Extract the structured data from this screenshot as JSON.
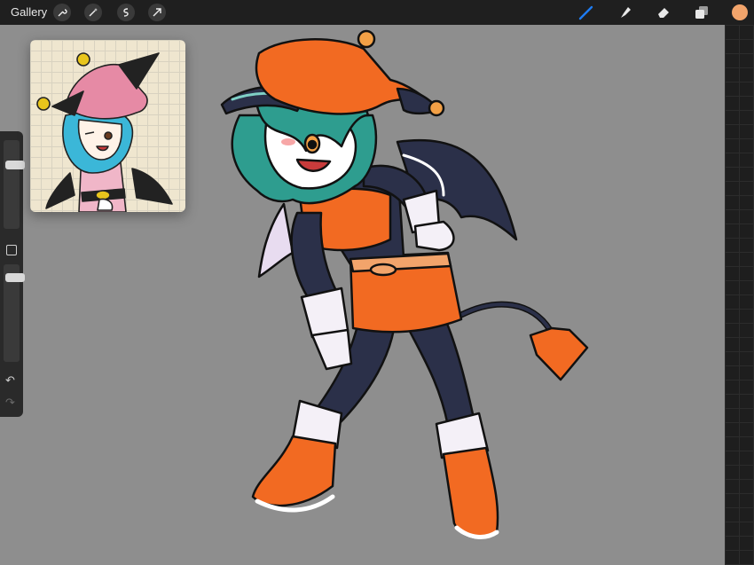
{
  "topbar": {
    "gallery_label": "Gallery",
    "left_tools": [
      "wrench-icon",
      "magic-wand-icon",
      "selection-icon",
      "transform-arrow-icon"
    ],
    "right_tools": [
      "brush-icon",
      "smudge-icon",
      "eraser-icon",
      "layers-icon"
    ],
    "active_tool": "brush-icon",
    "accent_color": "#1e7cf2",
    "current_color": "#f2a46b"
  },
  "sidebar": {
    "brush_size_level": 0.25,
    "opacity_level": 0.1
  },
  "canvas": {
    "background_color": "#8e8e8e"
  },
  "colors": {
    "orange": "#f26a22",
    "navy": "#2b3049",
    "teal_hair": "#2e9d8f",
    "pink_hat": "#e68aa5"
  }
}
